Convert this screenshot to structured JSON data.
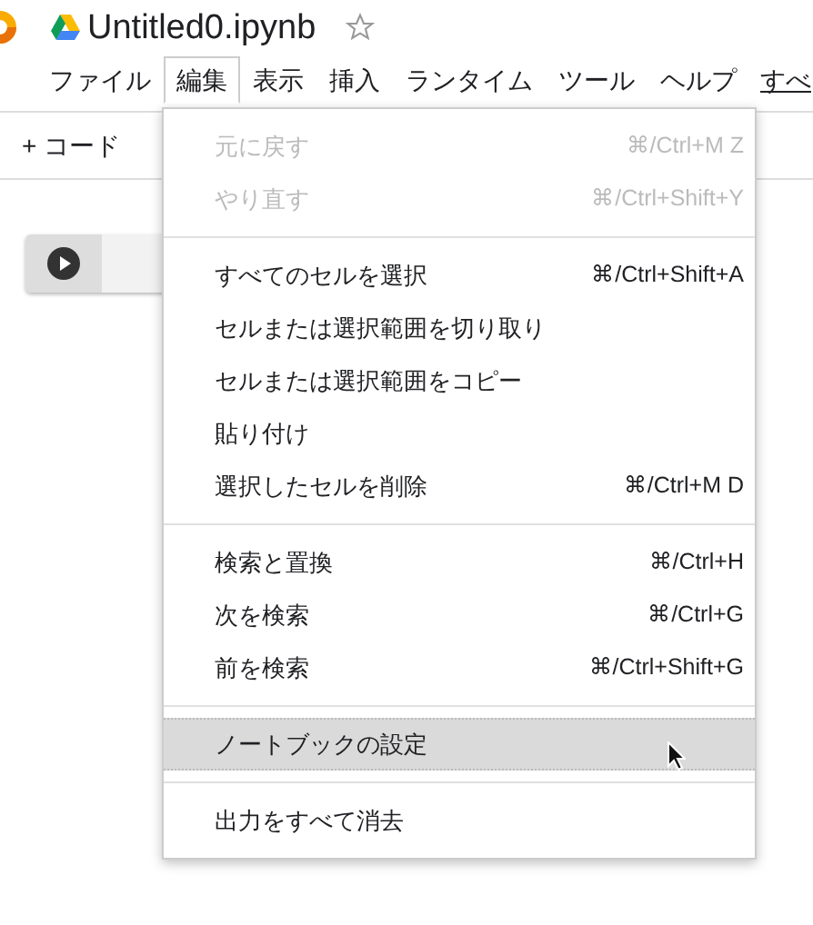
{
  "title": "Untitled0.ipynb",
  "menubar": [
    {
      "label": "ファイル",
      "selected": false
    },
    {
      "label": "編集",
      "selected": true
    },
    {
      "label": "表示",
      "selected": false
    },
    {
      "label": "挿入",
      "selected": false
    },
    {
      "label": "ランタイム",
      "selected": false
    },
    {
      "label": "ツール",
      "selected": false
    },
    {
      "label": "ヘルプ",
      "selected": false
    }
  ],
  "menubar_link": "すべ",
  "toolbar": {
    "add_code": "+ コード"
  },
  "edit_menu": [
    [
      {
        "label": "元に戻す",
        "shortcut": "⌘/Ctrl+M Z",
        "disabled": true,
        "selected": false
      },
      {
        "label": "やり直す",
        "shortcut": "⌘/Ctrl+Shift+Y",
        "disabled": true,
        "selected": false
      }
    ],
    [
      {
        "label": "すべてのセルを選択",
        "shortcut": "⌘/Ctrl+Shift+A",
        "disabled": false,
        "selected": false
      },
      {
        "label": "セルまたは選択範囲を切り取り",
        "disabled": false,
        "selected": false
      },
      {
        "label": "セルまたは選択範囲をコピー",
        "disabled": false,
        "selected": false
      },
      {
        "label": "貼り付け",
        "disabled": false,
        "selected": false
      },
      {
        "label": "選択したセルを削除",
        "shortcut": "⌘/Ctrl+M D",
        "disabled": false,
        "selected": false
      }
    ],
    [
      {
        "label": "検索と置換",
        "shortcut": "⌘/Ctrl+H",
        "disabled": false,
        "selected": false
      },
      {
        "label": "次を検索",
        "shortcut": "⌘/Ctrl+G",
        "disabled": false,
        "selected": false
      },
      {
        "label": "前を検索",
        "shortcut": "⌘/Ctrl+Shift+G",
        "disabled": false,
        "selected": false
      }
    ],
    [
      {
        "label": "ノートブックの設定",
        "disabled": false,
        "selected": true
      }
    ],
    [
      {
        "label": "出力をすべて消去",
        "disabled": false,
        "selected": false
      }
    ]
  ]
}
